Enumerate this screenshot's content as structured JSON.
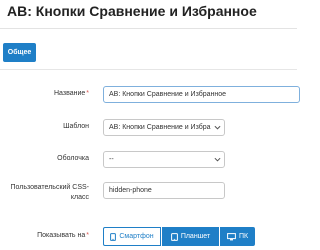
{
  "page": {
    "title": "AB: Кнопки Сравнение и Избранное"
  },
  "tabs": [
    {
      "label": "Общее",
      "active": true
    }
  ],
  "form": {
    "name": {
      "label": "Название",
      "required": true,
      "value": "AB: Кнопки Сравнение и Избранное"
    },
    "template": {
      "label": "Шаблон",
      "value": "AB: Кнопки Сравнение и Избра"
    },
    "shell": {
      "label": "Оболочка",
      "value": "--"
    },
    "css_class": {
      "label_line1": "Пользовательский CSS-",
      "label_line2": "класс",
      "value": "hidden-phone"
    },
    "show_on": {
      "label": "Показывать на",
      "required": true,
      "options": [
        {
          "label": "Смартфон",
          "icon": "smartphone-icon",
          "selected": false
        },
        {
          "label": "Планшет",
          "icon": "tablet-icon",
          "selected": true
        },
        {
          "label": "ПК",
          "icon": "desktop-icon",
          "selected": true
        }
      ]
    }
  },
  "colors": {
    "accent": "#1f7fc7",
    "required": "#d9534f"
  }
}
